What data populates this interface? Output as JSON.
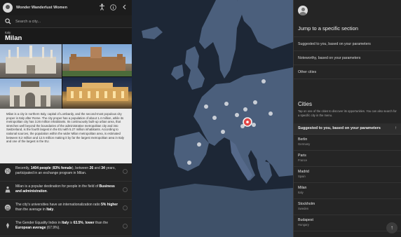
{
  "app": {
    "title": "Wonder Wanderlust Women"
  },
  "search": {
    "placeholder": "Search a city..."
  },
  "city": {
    "country": "Italy",
    "name": "Milan",
    "description": "Milan is a city in northern Italy, capital of Lombardy, and the second-most populous city proper in Italy after Rome. The city proper has a population of about 1.4 million, while its metropolitan city has 3.26 million inhabitants. Its continuously built-up urban area, that stretches well beyond the boundaries of the administrative metropolitan city and into Switzerland, is the fourth largest in the EU with 5.27 million inhabitants. According to national sources, the population within the wider Milan metropolitan area, is estimated between 8.2 million and 12.5 million making it by far the largest metropolitan area in Italy and one of the largest in the EU."
  },
  "facts": [
    {
      "icon": "globe-icon",
      "parts": {
        "a": "Recently, ",
        "b": "1404 people",
        "c": " (",
        "d": "83% female",
        "e": "), between ",
        "f": "26",
        "g": " and ",
        "h": "34",
        "i": " years, participated in an exchange program in Milan."
      }
    },
    {
      "icon": "briefcase-icon",
      "parts": {
        "a": "Milan is a popular destination for people in the field of ",
        "b": "Business and administration",
        "c": "."
      }
    },
    {
      "icon": "university-icon",
      "parts": {
        "a": "The city's universities have an internationalization ratio ",
        "b": "5% higher",
        "c": " than the average in ",
        "d": "Italy",
        "e": "."
      }
    },
    {
      "icon": "gender-icon",
      "parts": {
        "a": "The Gender Equality Index in ",
        "b": "Italy",
        "c": " is ",
        "d": "63.5%",
        "e": ", ",
        "f": "lower",
        "g": " than the ",
        "h": "European average",
        "i": " (67.9%)."
      }
    }
  ],
  "right": {
    "jump_title": "Jump to a specific section",
    "jump_items": [
      "Suggested to you, based on your parameters",
      "Noteworthy, based on your parameters",
      "Other cities"
    ],
    "cities_title": "Cities",
    "cities_desc": "Tap on one of the cities to discover its opportunities. You can also search for a specific city in the menu.",
    "suggested_title": "Suggested to you, based on your parameters",
    "cities": [
      {
        "name": "Berlin",
        "country": "Germany"
      },
      {
        "name": "Paris",
        "country": "France"
      },
      {
        "name": "Madrid",
        "country": "Spain"
      },
      {
        "name": "Milan",
        "country": "Italy"
      },
      {
        "name": "Stockholm",
        "country": "Sweden"
      },
      {
        "name": "Budapest",
        "country": "Hungary"
      }
    ]
  },
  "colors": {
    "accent_green": "#5cc36b",
    "accent_red": "#e25b5b",
    "map_water": "#1d2736",
    "map_land": "#4b5f7c",
    "selected_pin": "#e04848"
  }
}
